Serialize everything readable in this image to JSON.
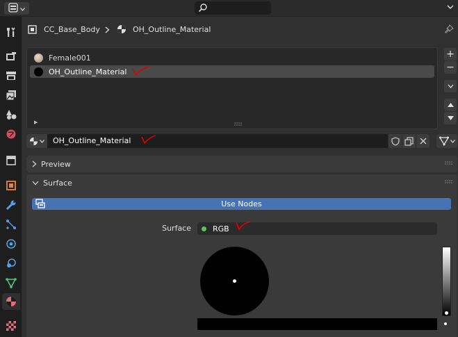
{
  "colors": {
    "accent": "#4772b3",
    "annotation": "#e00000",
    "socket_green": "#5fc05f",
    "surface_color": "#000000"
  },
  "header": {
    "editor_type_icon": "properties-editor-icon",
    "search_icon": "search-icon"
  },
  "tabs": [
    {
      "name": "tool",
      "icon": "wrench-screwdriver-icon"
    },
    {
      "name": "render",
      "icon": "camera-back-icon"
    },
    {
      "name": "output",
      "icon": "printer-icon"
    },
    {
      "name": "view-layer",
      "icon": "image-stack-icon"
    },
    {
      "name": "scene",
      "icon": "cone-sphere-icon"
    },
    {
      "name": "world",
      "icon": "globe-icon"
    },
    {
      "name": "collection",
      "icon": "box-icon"
    },
    {
      "name": "object",
      "icon": "orange-square-icon"
    },
    {
      "name": "modifiers",
      "icon": "wrench-icon"
    },
    {
      "name": "particles",
      "icon": "particles-icon"
    },
    {
      "name": "physics",
      "icon": "physics-icon"
    },
    {
      "name": "constraints",
      "icon": "constraint-icon"
    },
    {
      "name": "data",
      "icon": "vertex-data-icon"
    },
    {
      "name": "material",
      "icon": "material-sphere-icon",
      "active": true
    },
    {
      "name": "texture",
      "icon": "checker-texture-icon"
    }
  ],
  "breadcrumb": {
    "object": "CC_Base_Body",
    "material": "OH_Outline_Material"
  },
  "material_slots": [
    {
      "label": "Female001",
      "color": "#c9b6a8",
      "selected": false
    },
    {
      "label": "OH_Outline_Material",
      "color": "#000000",
      "selected": true
    }
  ],
  "slot_buttons": {
    "add": "+",
    "remove": "−"
  },
  "datablock": {
    "name": "OH_Outline_Material"
  },
  "panels": {
    "preview": "Preview",
    "surface": "Surface"
  },
  "surface": {
    "use_nodes_label": "Use Nodes",
    "label": "Surface",
    "value": "RGB"
  }
}
